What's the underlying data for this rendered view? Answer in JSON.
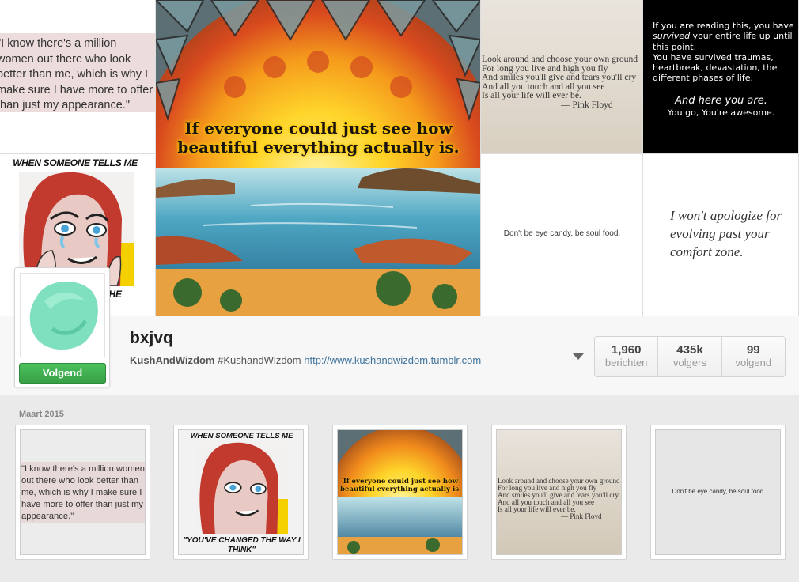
{
  "colors": {
    "follow_button": "#37a046",
    "link": "#3f729b",
    "stats_border": "#d3d3d3",
    "background": "#eaeaea"
  },
  "mosaic": {
    "tile1_quote": "\"I know there's a million women out there who look better than me, which is why I make sure I have more to offer than just my appearance.\"",
    "tile2_caption": "WHEN SOMEONE TELLS ME",
    "tile2_caption_bottom": "THE",
    "tile3_quote": "If everyone could just see how beautiful everything actually is.",
    "tile4_poem": "Look around and choose your own ground\nFor long you live and high you fly\nAnd smiles you'll give and tears you'll cry\nAnd all you touch and all you see\nIs all your life will ever be.",
    "tile4_author": "— Pink Floyd",
    "tile5_line1_a": "If you are reading this, you have ",
    "tile5_line1_em": "survived",
    "tile5_line1_b": " your entire life up until this point.",
    "tile5_line2": "You have survived traumas, heartbreak, devastation, the different phases of life.",
    "tile5_big": "And here you are.",
    "tile5_small": "You go,   You're awesome.",
    "tile6_text": "Don't be eye candy, be soul food.",
    "tile7_text": "I won't apologize for evolving past your comfort zone."
  },
  "profile": {
    "username": "bxjvq",
    "bio_name": "KushAndWizdom",
    "bio_tag": "#KushandWizdom",
    "bio_link": "http://www.kushandwizdom.tumblr.com",
    "follow_label": "Volgend",
    "stats": [
      {
        "value": "1,960",
        "label": "berichten"
      },
      {
        "value": "435k",
        "label": "volgers"
      },
      {
        "value": "99",
        "label": "volgend"
      }
    ]
  },
  "feed": {
    "month": "Maart 2015",
    "thumbs": [
      {
        "text": "\"I know there's a million women out there who look better than me, which is why I make sure I have more to offer than just my appearance.\""
      },
      {
        "caption_top": "WHEN SOMEONE TELLS ME",
        "caption_bottom": "\"YOU'VE CHANGED THE WAY I THINK\""
      },
      {
        "text": "If everyone could just see how beautiful everything actually is."
      },
      {
        "text": "Look around and choose your own ground\nFor long you live and high you fly\nAnd smiles you'll give and tears you'll cry\nAnd all you touch and all you see\nIs all your life will ever be.",
        "author": "— Pink Floyd"
      },
      {
        "text": "Don't be eye candy, be soul food."
      }
    ]
  }
}
